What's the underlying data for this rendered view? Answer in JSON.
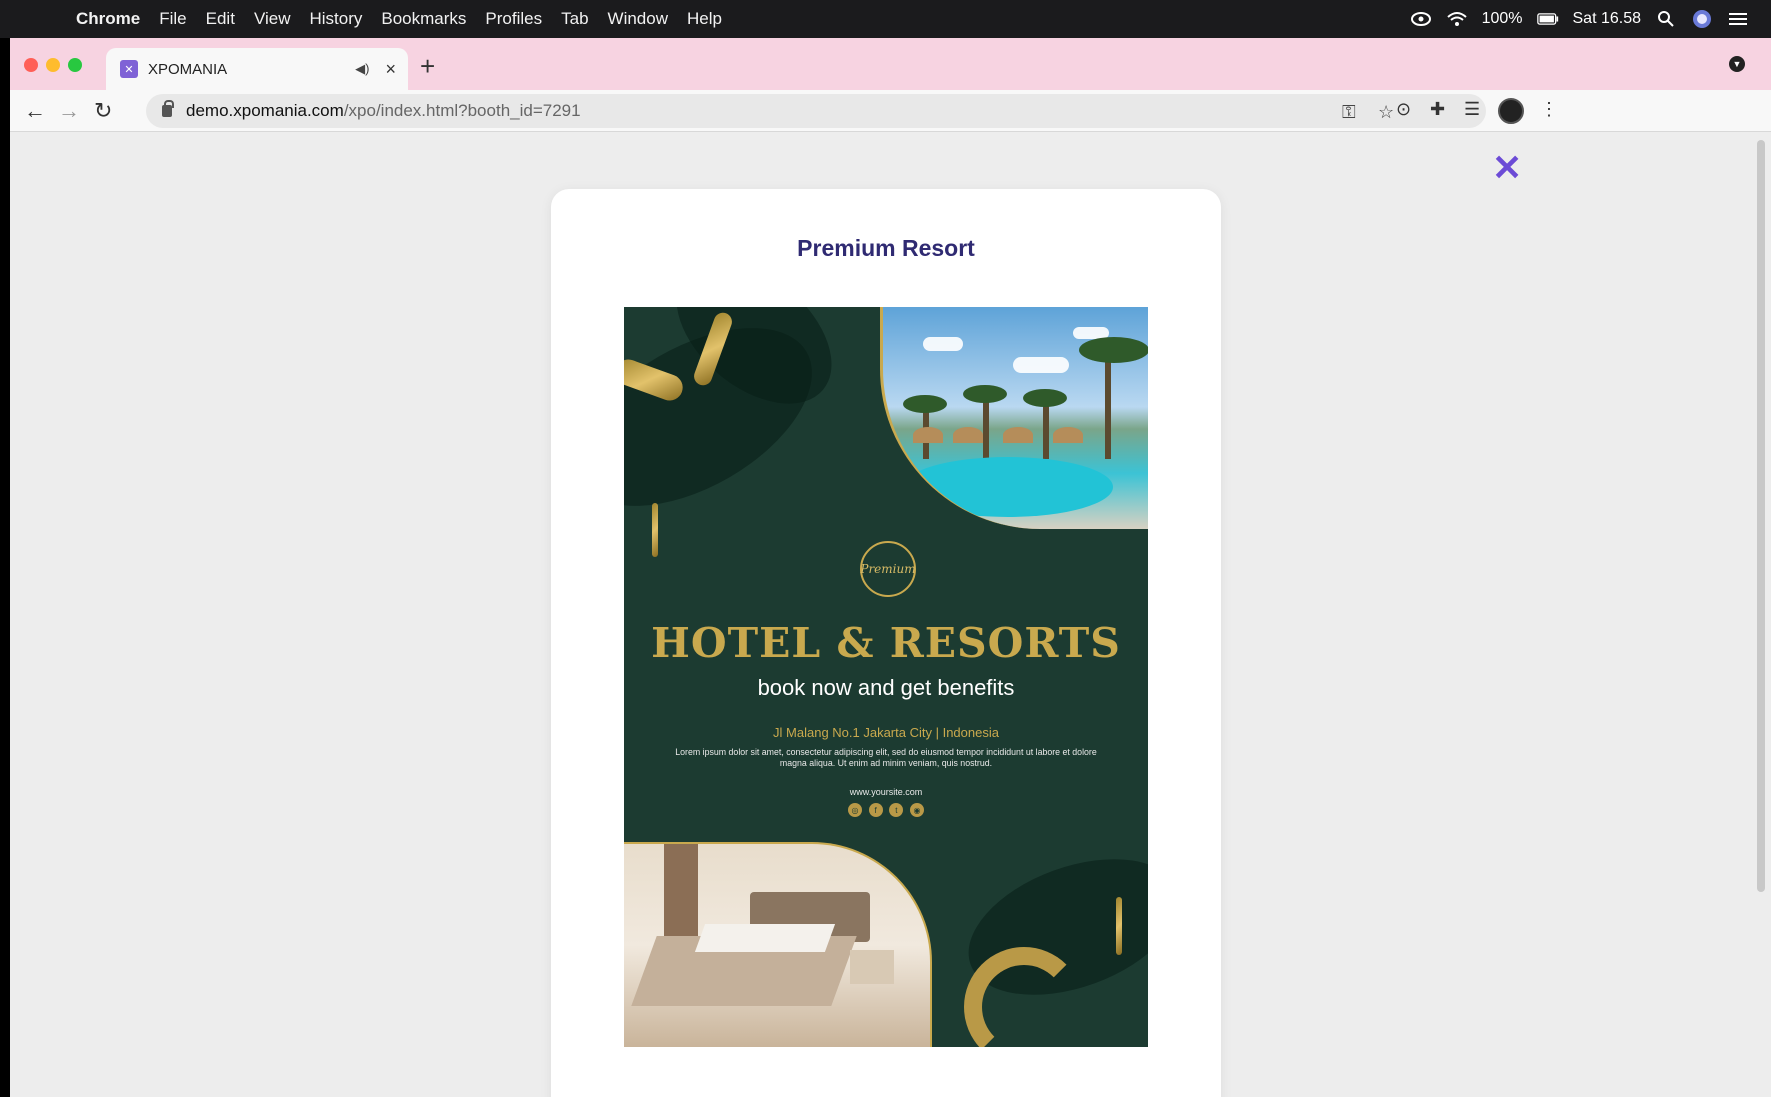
{
  "menubar": {
    "app": "Chrome",
    "items": [
      "File",
      "Edit",
      "View",
      "History",
      "Bookmarks",
      "Profiles",
      "Tab",
      "Window",
      "Help"
    ],
    "battery": "100%",
    "datetime": "Sat 16.58"
  },
  "browser": {
    "tab_title": "XPOMANIA",
    "url_host": "demo.xpomania.com",
    "url_path": "/xpo/index.html?booth_id=7291"
  },
  "modal": {
    "title": "Premium Resort",
    "close_glyph": "✕"
  },
  "poster": {
    "logo_text": "Premium",
    "headline": "HOTEL & RESORTS",
    "subline": "book now and get benefits",
    "address": "Jl Malang No.1 Jakarta City | Indonesia",
    "lorem": "Lorem ipsum dolor sit amet, consectetur adipiscing elit, sed do eiusmod tempor incididunt ut labore et dolore magna aliqua. Ut enim ad minim veniam, quis nostrud.",
    "website": "www.yoursite.com",
    "social_icons": [
      "instagram-icon",
      "facebook-icon",
      "twitter-icon",
      "whatsapp-icon"
    ]
  },
  "colors": {
    "accent": "#6c4bd6",
    "title": "#2f2a72",
    "poster_green": "#1c3b31",
    "gold": "#c9a94e",
    "tabstrip": "#f7d3e1"
  }
}
